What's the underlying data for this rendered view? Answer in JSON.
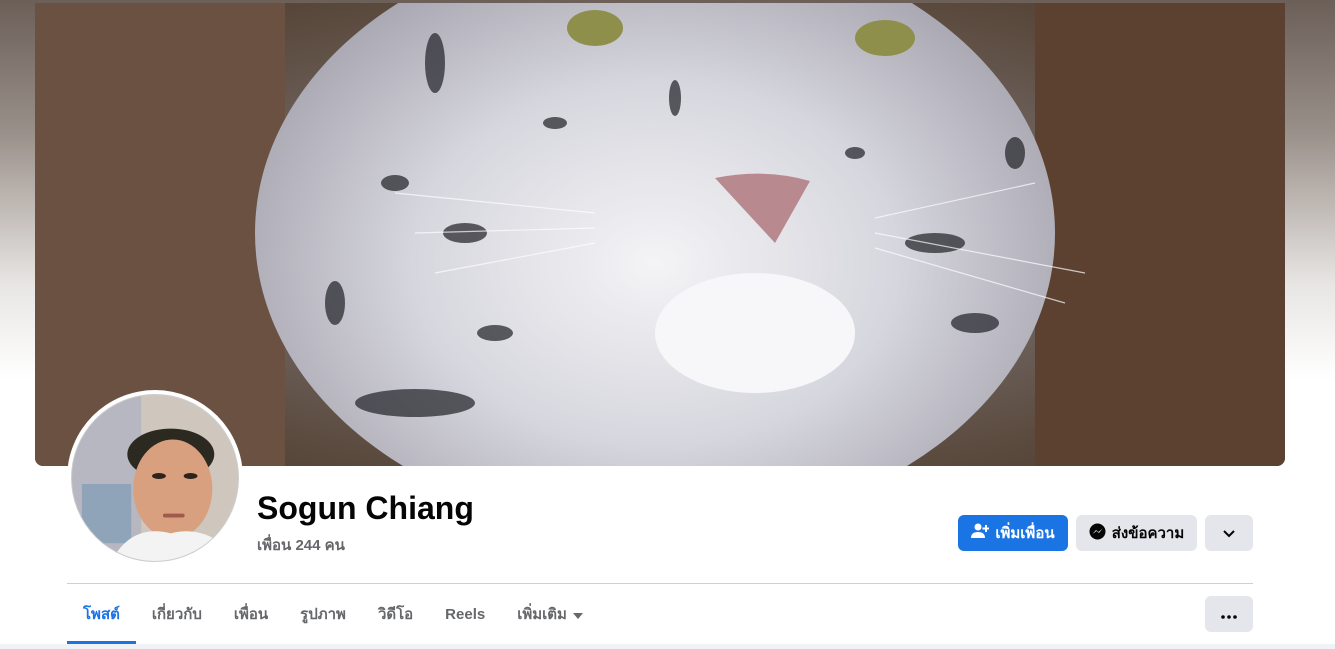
{
  "profile": {
    "name": "Sogun Chiang",
    "friends_count": "เพื่อน 244 คน"
  },
  "actions": {
    "add_friend": "เพิ่มเพื่อน",
    "message": "ส่งข้อความ"
  },
  "tabs": [
    {
      "label": "โพสต์",
      "active": true
    },
    {
      "label": "เกี่ยวกับ"
    },
    {
      "label": "เพื่อน"
    },
    {
      "label": "รูปภาพ"
    },
    {
      "label": "วิดีโอ"
    },
    {
      "label": "Reels"
    },
    {
      "label": "เพิ่มเติม"
    }
  ],
  "colors": {
    "accent": "#1b74e4",
    "secondary_button": "#e4e6eb",
    "muted_text": "#65676b"
  },
  "icons": {
    "add_friend": "person-plus-icon",
    "message": "messenger-icon",
    "more": "chevron-down-icon",
    "tab_more": "caret-down-icon",
    "overflow": "ellipsis-icon"
  }
}
